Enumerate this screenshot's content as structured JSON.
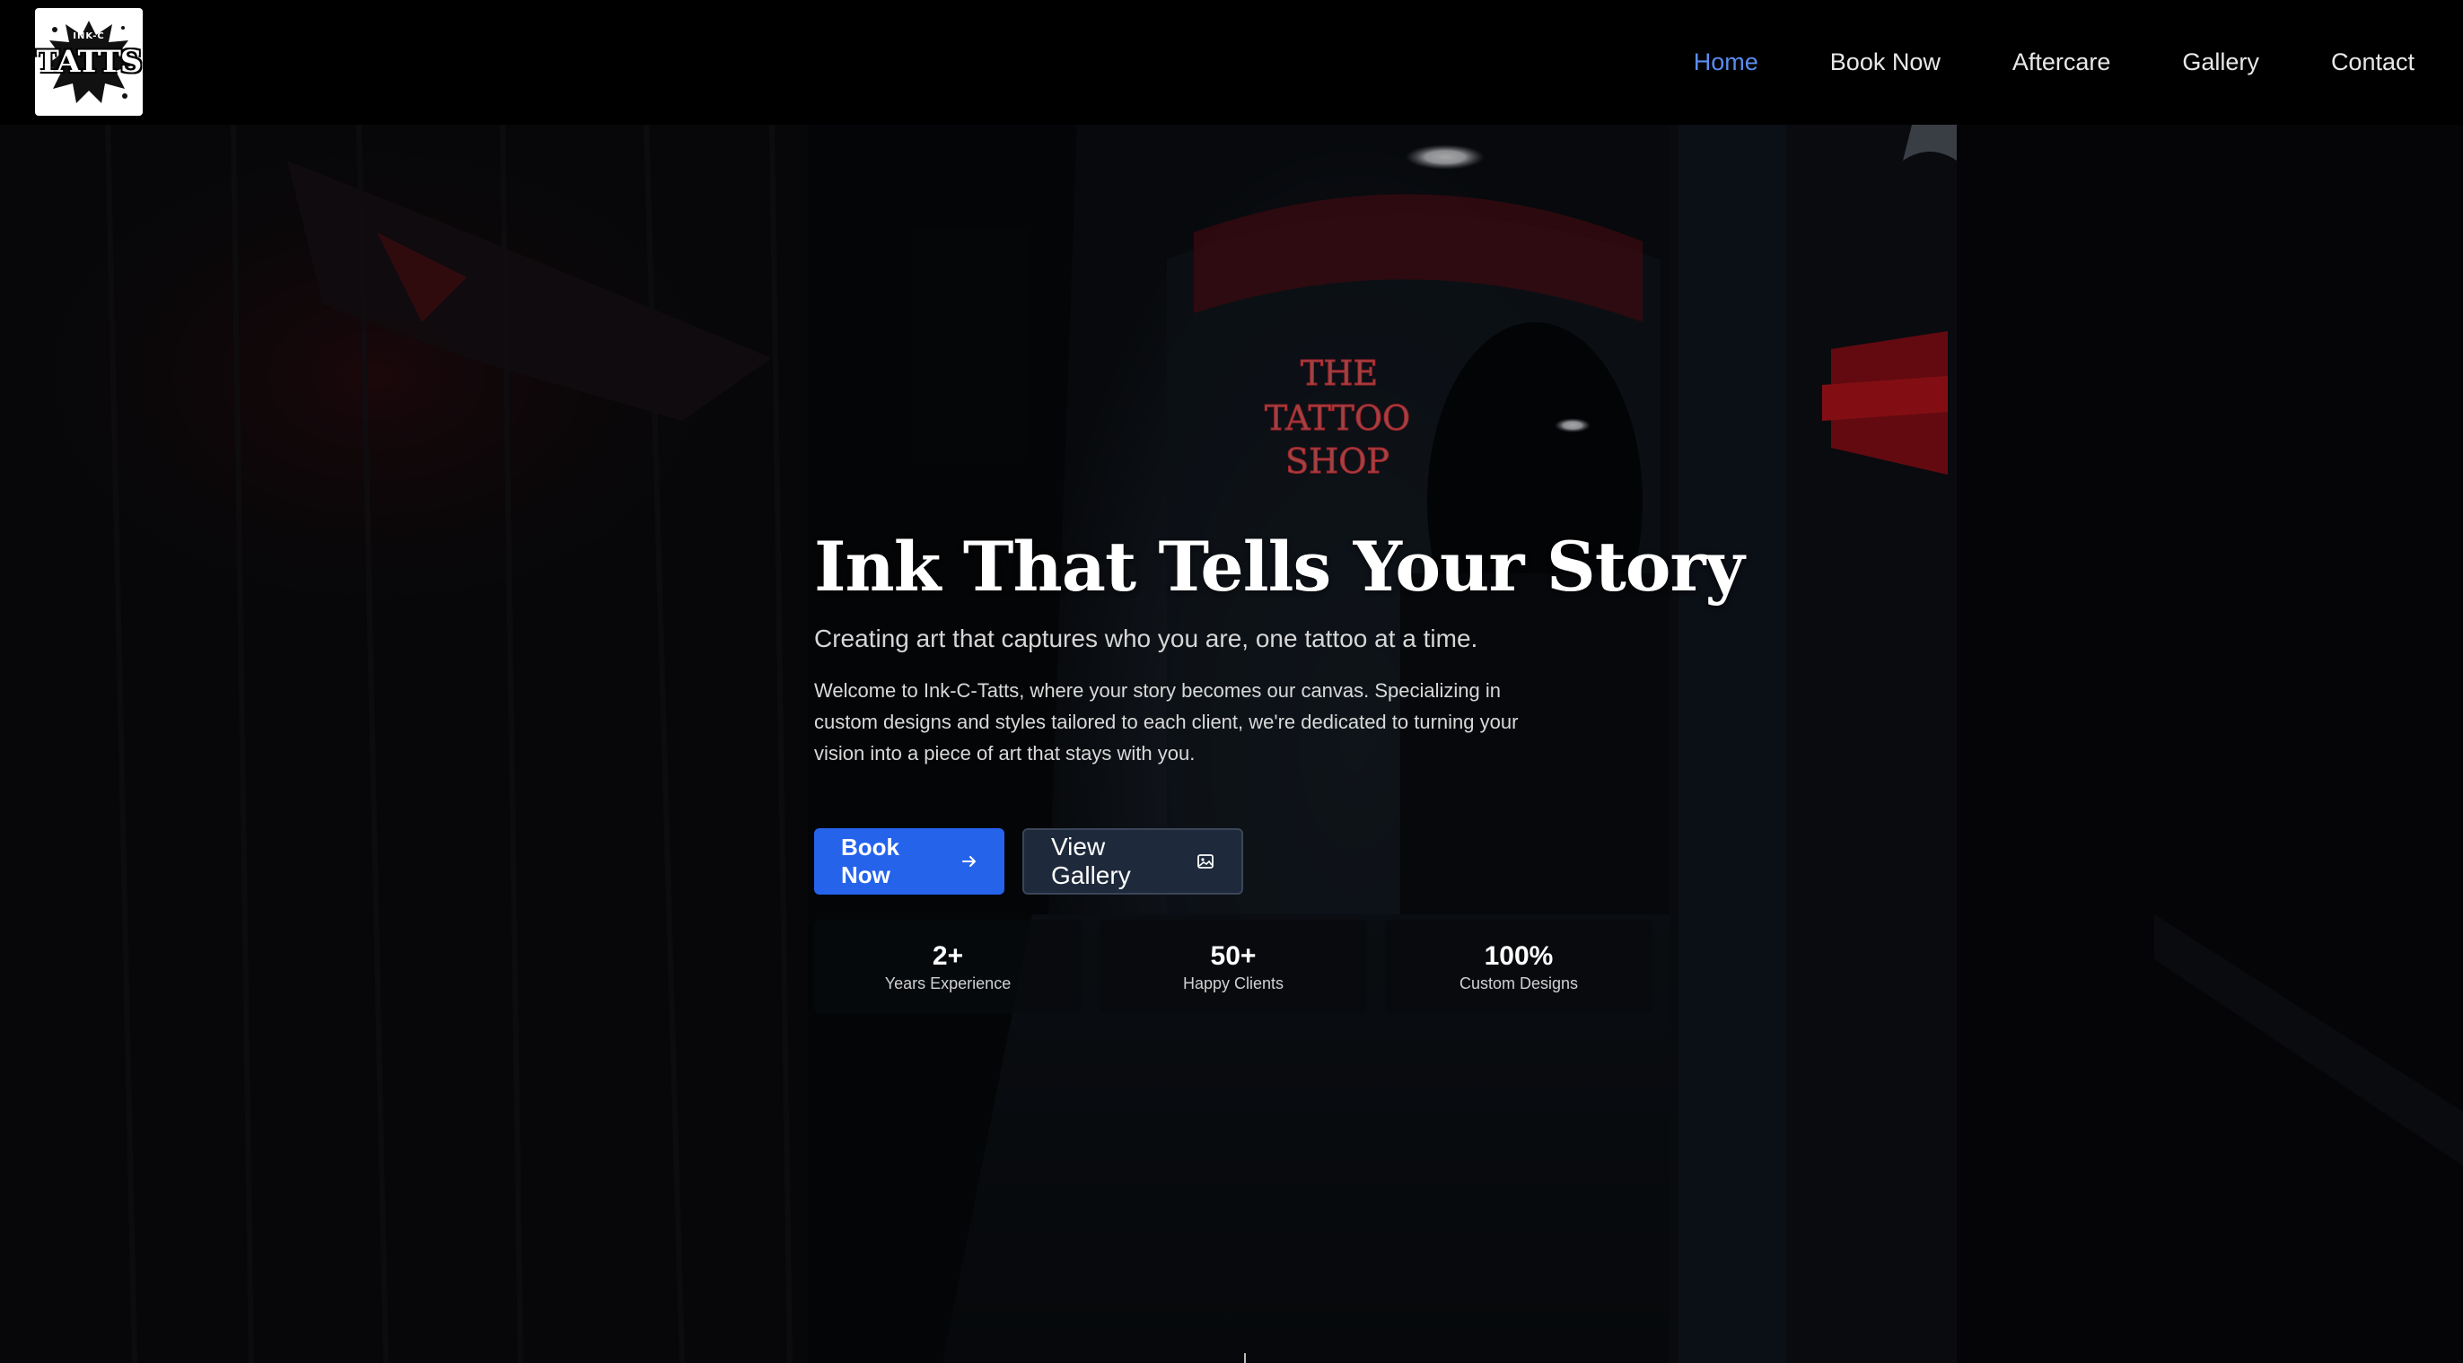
{
  "header": {
    "logo": {
      "small_text": "INK-C",
      "big_text": "TATTS"
    },
    "nav": [
      {
        "label": "Home",
        "active": true
      },
      {
        "label": "Book Now",
        "active": false
      },
      {
        "label": "Aftercare",
        "active": false
      },
      {
        "label": "Gallery",
        "active": false
      },
      {
        "label": "Contact",
        "active": false
      }
    ]
  },
  "hero": {
    "background_sign": [
      "THE",
      "TATTOO",
      "SHOP"
    ],
    "headline": "Ink That Tells Your Story",
    "tagline": "Creating art that captures who you are, one tattoo at a time.",
    "intro": "Welcome to Ink-C-Tatts, where your story becomes our canvas. Specializing in custom designs and styles tailored to each client, we're dedicated to turning your vision into a piece of art that stays with you.",
    "primary_button": {
      "label": "Book Now",
      "icon": "arrow-right-icon"
    },
    "secondary_button": {
      "label": "View Gallery",
      "icon": "image-icon"
    },
    "stats": [
      {
        "value": "2+",
        "label": "Years Experience"
      },
      {
        "value": "50+",
        "label": "Happy Clients"
      },
      {
        "value": "100%",
        "label": "Custom Designs"
      }
    ]
  },
  "colors": {
    "accent": "#2563eb",
    "nav_active": "#5b8def",
    "neon_red": "#e11d2a"
  }
}
